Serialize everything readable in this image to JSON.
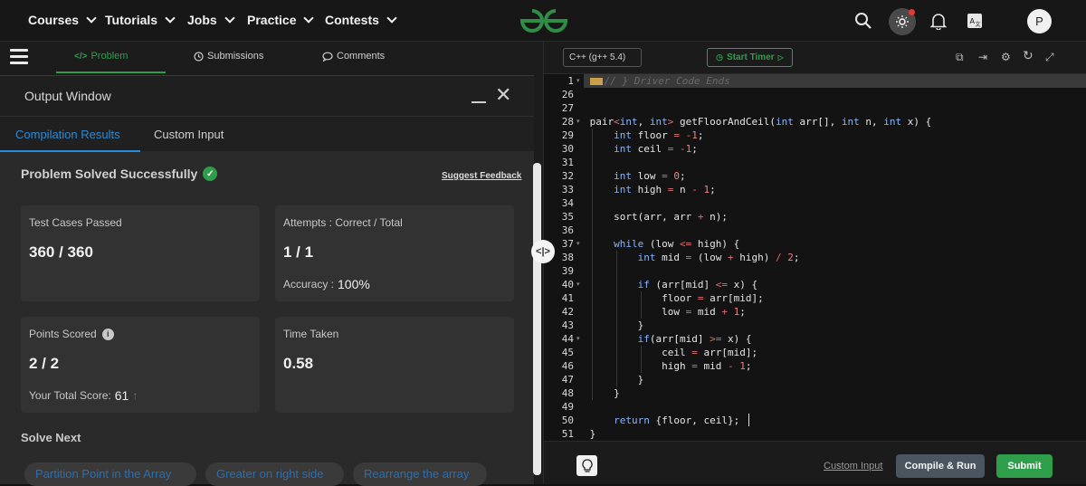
{
  "nav": {
    "items": [
      "Courses",
      "Tutorials",
      "Jobs",
      "Practice",
      "Contests"
    ],
    "avatar_initial": "P",
    "brand_color": "#2f8d46"
  },
  "subnav": {
    "problem": "Problem",
    "submissions": "Submissions",
    "comments": "Comments"
  },
  "output": {
    "title": "Output Window",
    "tabs": [
      "Compilation Results",
      "Custom Input"
    ],
    "status": "Problem Solved Successfully",
    "suggest_feedback": "Suggest Feedback",
    "cards": {
      "test_cases": {
        "label": "Test Cases Passed",
        "value": "360 / 360"
      },
      "attempts": {
        "label": "Attempts : Correct / Total",
        "value": "1 / 1",
        "sub_label": "Accuracy :",
        "sub_value": "100%"
      },
      "points": {
        "label": "Points Scored",
        "value": "2 / 2",
        "sub_label": "Your Total Score:",
        "sub_value": "61"
      },
      "time": {
        "label": "Time Taken",
        "value": "0.58"
      }
    },
    "solve_next_label": "Solve Next",
    "solve_next": [
      "Partition Point in the Array",
      "Greater on right side",
      "Rearrange the array"
    ]
  },
  "editor": {
    "language": "C++ (g++ 5.4)",
    "start_timer": "Start Timer",
    "first_line_comment": "// } Driver Code Ends",
    "line_numbers": [
      "1",
      "26",
      "27",
      "28",
      "29",
      "30",
      "31",
      "32",
      "33",
      "34",
      "35",
      "36",
      "37",
      "38",
      "39",
      "40",
      "41",
      "42",
      "43",
      "44",
      "45",
      "46",
      "47",
      "48",
      "49",
      "50",
      "51"
    ],
    "custom_input": "Custom Input",
    "compile_run": "Compile & Run",
    "submit": "Submit"
  }
}
